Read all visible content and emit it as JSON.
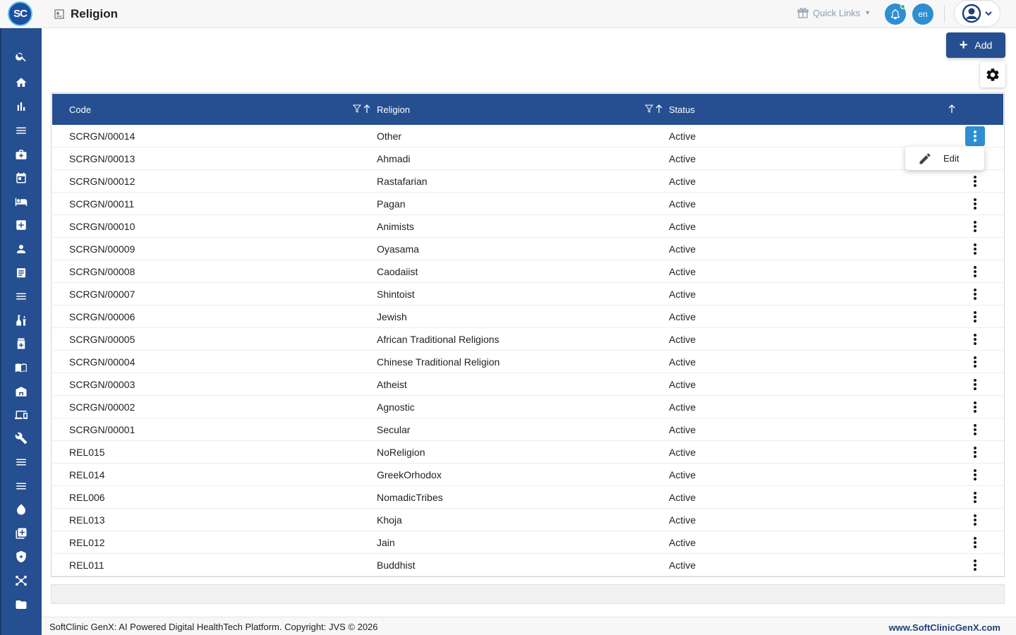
{
  "app": {
    "logo_text": "SC",
    "page_title": "Religion"
  },
  "header": {
    "quick_links_label": "Quick Links",
    "lang_label": "en"
  },
  "sidebar": {
    "items": [
      {
        "icon": "search-icon"
      },
      {
        "icon": "home-icon"
      },
      {
        "icon": "bar-chart-icon"
      },
      {
        "icon": "menu-icon"
      },
      {
        "icon": "medical-bag-icon"
      },
      {
        "icon": "calendar-icon"
      },
      {
        "icon": "bed-icon"
      },
      {
        "icon": "medical-plus-icon"
      },
      {
        "icon": "person-icon"
      },
      {
        "icon": "receipt-icon"
      },
      {
        "icon": "list-icon"
      },
      {
        "icon": "lab-icon"
      },
      {
        "icon": "pharmacy-icon"
      },
      {
        "icon": "book-icon"
      },
      {
        "icon": "store-icon"
      },
      {
        "icon": "devices-icon"
      },
      {
        "icon": "wrench-icon"
      },
      {
        "icon": "list-icon"
      },
      {
        "icon": "list-icon"
      },
      {
        "icon": "drop-icon"
      },
      {
        "icon": "add-box-icon"
      },
      {
        "icon": "shield-icon"
      },
      {
        "icon": "network-icon"
      },
      {
        "icon": "folder-icon"
      }
    ]
  },
  "toolbar": {
    "add_label": "Add"
  },
  "table": {
    "columns": [
      "Code",
      "Religion",
      "Status"
    ],
    "rows": [
      {
        "code": "SCRGN/00014",
        "religion": "Other",
        "status": "Active"
      },
      {
        "code": "SCRGN/00013",
        "religion": "Ahmadi",
        "status": "Active"
      },
      {
        "code": "SCRGN/00012",
        "religion": "Rastafarian",
        "status": "Active"
      },
      {
        "code": "SCRGN/00011",
        "religion": "Pagan",
        "status": "Active"
      },
      {
        "code": "SCRGN/00010",
        "religion": "Animists",
        "status": "Active"
      },
      {
        "code": "SCRGN/00009",
        "religion": "Oyasama",
        "status": "Active"
      },
      {
        "code": "SCRGN/00008",
        "religion": "Caodaiist",
        "status": "Active"
      },
      {
        "code": "SCRGN/00007",
        "religion": "Shintoist",
        "status": "Active"
      },
      {
        "code": "SCRGN/00006",
        "religion": "Jewish",
        "status": "Active"
      },
      {
        "code": "SCRGN/00005",
        "religion": "African Traditional Religions",
        "status": "Active"
      },
      {
        "code": "SCRGN/00004",
        "religion": "Chinese Traditional Religion",
        "status": "Active"
      },
      {
        "code": "SCRGN/00003",
        "religion": "Atheist",
        "status": "Active"
      },
      {
        "code": "SCRGN/00002",
        "religion": "Agnostic",
        "status": "Active"
      },
      {
        "code": "SCRGN/00001",
        "religion": "Secular",
        "status": "Active"
      },
      {
        "code": "REL015",
        "religion": "NoReligion",
        "status": "Active"
      },
      {
        "code": "REL014",
        "religion": "GreekOrhodox",
        "status": "Active"
      },
      {
        "code": "REL006",
        "religion": "NomadicTribes",
        "status": "Active"
      },
      {
        "code": "REL013",
        "religion": "Khoja",
        "status": "Active"
      },
      {
        "code": "REL012",
        "religion": "Jain",
        "status": "Active"
      },
      {
        "code": "REL011",
        "religion": "Buddhist",
        "status": "Active"
      }
    ]
  },
  "row_menu": {
    "edit_label": "Edit"
  },
  "footer": {
    "copyright": "SoftClinic GenX: AI Powered Digital HealthTech Platform. Copyright: JVS © 2026",
    "website": "www.SoftClinicGenX.com"
  },
  "colors": {
    "primary": "#264f91",
    "accent": "#2d8fd2",
    "notification_dot": "#2ec46b"
  }
}
